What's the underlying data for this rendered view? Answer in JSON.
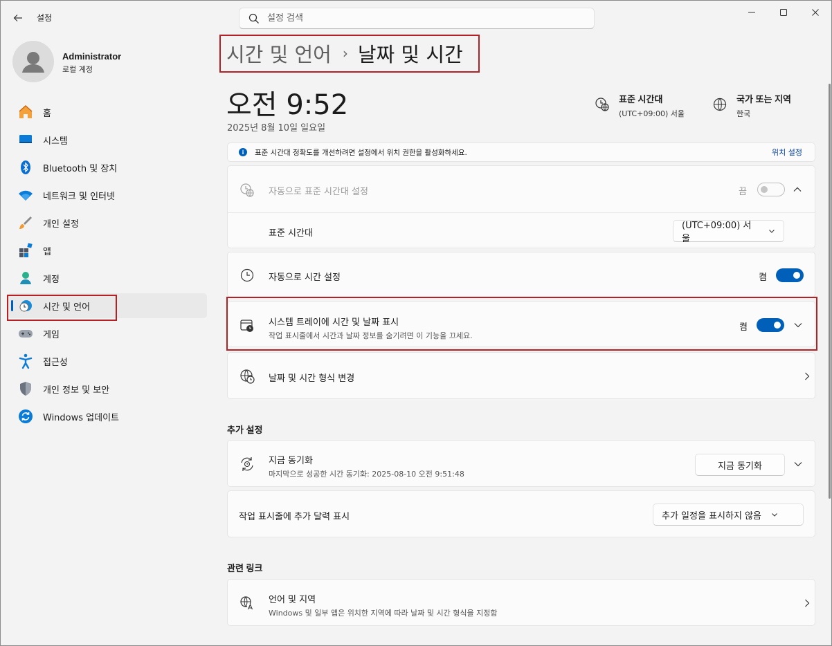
{
  "window": {
    "app_title": "설정",
    "minimize_icon": "minimize-icon",
    "maximize_icon": "maximize-icon",
    "close_icon": "close-icon"
  },
  "search": {
    "placeholder": "설정 검색",
    "value": ""
  },
  "user": {
    "name": "Administrator",
    "account_type": "로컬 계정"
  },
  "sidebar": {
    "items": [
      {
        "label": "홈",
        "icon": "home-icon"
      },
      {
        "label": "시스템",
        "icon": "system-icon"
      },
      {
        "label": "Bluetooth 및 장치",
        "icon": "bluetooth-icon"
      },
      {
        "label": "네트워크 및 인터넷",
        "icon": "wifi-icon"
      },
      {
        "label": "개인 설정",
        "icon": "brush-icon"
      },
      {
        "label": "앱",
        "icon": "apps-icon"
      },
      {
        "label": "계정",
        "icon": "account-icon"
      },
      {
        "label": "시간 및 언어",
        "icon": "time-language-icon",
        "active": true
      },
      {
        "label": "게임",
        "icon": "gaming-icon"
      },
      {
        "label": "접근성",
        "icon": "accessibility-icon"
      },
      {
        "label": "개인 정보 및 보안",
        "icon": "shield-icon"
      },
      {
        "label": "Windows 업데이트",
        "icon": "update-icon"
      }
    ]
  },
  "header": {
    "parent": "시간 및 언어",
    "separator": "›",
    "current": "날짜 및 시간"
  },
  "clock": {
    "time": "오전 9:52",
    "date": "2025년 8월 10일 일요일"
  },
  "tz_summary": {
    "title": "표준 시간대",
    "value": "(UTC+09:00) 서울",
    "region_title": "국가 또는 지역",
    "region_value": "한국"
  },
  "info_bar": {
    "icon": "info-icon",
    "text": "표준 시간대 정확도를 개선하려면 설정에서 위치 권한을 활성화하세요.",
    "link": "위치 설정"
  },
  "auto_timezone": {
    "label": "자동으로 표준 시간대 설정",
    "state": "끔",
    "toggle_on": false
  },
  "timezone": {
    "label": "표준 시간대",
    "value": "(UTC+09:00) 서울"
  },
  "auto_time": {
    "label": "자동으로 시간 설정",
    "state": "켬",
    "toggle_on": true
  },
  "tray": {
    "label": "시스템 트레이에 시간 및 날짜 표시",
    "sub": "작업 표시줄에서 시간과 날짜 정보를 숨기려면 이 기능을 끄세요.",
    "state": "켬",
    "toggle_on": true
  },
  "format": {
    "label": "날짜 및 시간 형식 변경"
  },
  "additional": {
    "title": "추가 설정",
    "sync": {
      "label": "지금 동기화",
      "sub": "마지막으로 성공한 시간 동기화: 2025-08-10 오전 9:51:48",
      "button": "지금 동기화"
    },
    "calendar": {
      "label": "작업 표시줄에 추가 달력 표시",
      "value": "추가 일정을 표시하지 않음"
    }
  },
  "related": {
    "title": "관련 링크",
    "language": {
      "label": "언어 및 지역",
      "sub": "Windows 및 일부 앱은 위치한 지역에 따라 날짜 및 시간 형식을 지정함"
    }
  },
  "colors": {
    "accent": "#005fb8",
    "highlight_border": "#b52025"
  }
}
